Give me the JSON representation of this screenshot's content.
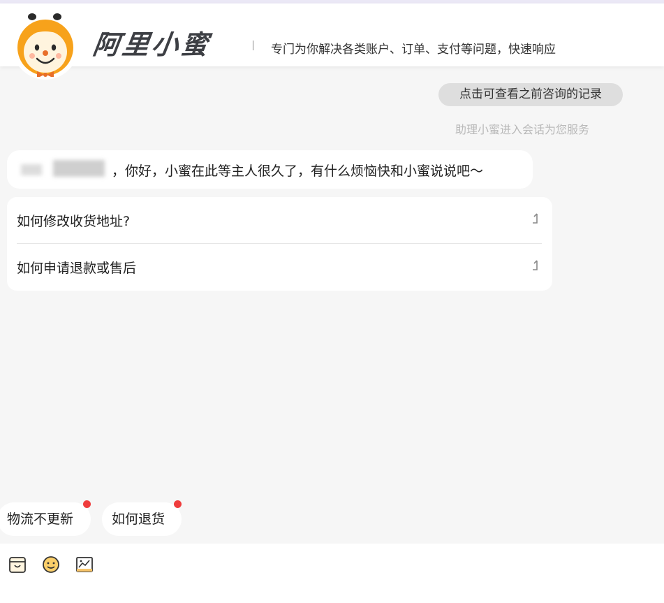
{
  "header": {
    "brand": "阿里小蜜",
    "slogan": "专门为你解决各类账户、订单、支付等问题，快速响应"
  },
  "history": {
    "button_label": "点击可查看之前咨询的记录",
    "status_text": "助理小蜜进入会话为您服务"
  },
  "greeting": {
    "text": "，你好，小蜜在此等主人很久了，有什么烦恼快和小蜜说说吧～"
  },
  "faq": {
    "items": [
      {
        "label": "如何修改收货地址?"
      },
      {
        "label": "如何申请退款或售后"
      }
    ]
  },
  "quick_replies": [
    {
      "label": "物流不更新"
    },
    {
      "label": "如何退货"
    }
  ],
  "toolbar": {
    "icons": [
      "order-bag-icon",
      "emoji-icon",
      "image-icon"
    ]
  },
  "colors": {
    "brand_orange": "#f7a21b",
    "badge_red": "#ef3c3c",
    "background": "#f6f6f6"
  }
}
